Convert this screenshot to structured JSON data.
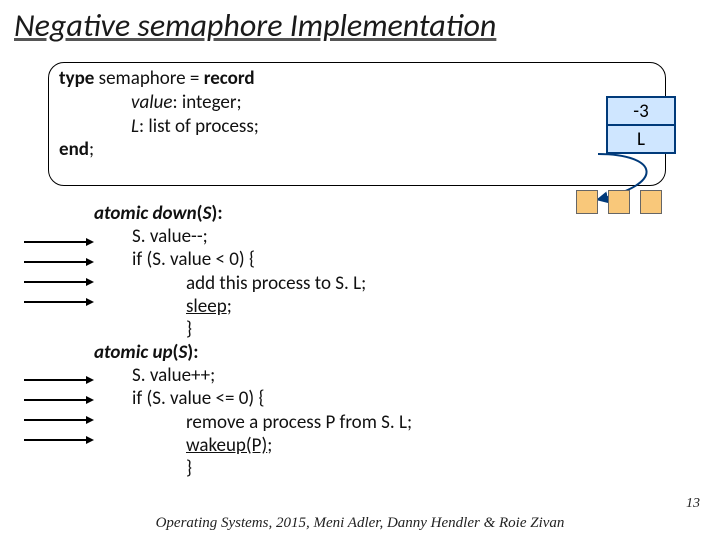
{
  "title": "Negative semaphore Implementation",
  "type_def": {
    "head_type": "type",
    "head_rest": " semaphore = ",
    "head_record": "record",
    "field1_name": "value",
    "field1_rest": ": integer;",
    "field2_name": "L",
    "field2_rest": ": list of process;",
    "end": "end"
  },
  "diagram": {
    "value": "-3",
    "list_label": "L"
  },
  "code": {
    "down_head_a": "atomic down",
    "down_head_b": "(",
    "down_head_c": "S",
    "down_head_d": "):",
    "d1": "S. value--;",
    "d2": "if (S. value < 0) {",
    "d3": "add this process to S. L;",
    "d4_u": "sleep",
    "d4_rest": ";",
    "d5": "}",
    "up_head_a": "atomic up",
    "up_head_b": "(",
    "up_head_c": "S",
    "up_head_d": "):",
    "u1": "S. value++;",
    "u2": "if (S. value <= 0) {",
    "u3": "remove a process P from S. L;",
    "u4_u": "wakeup(P)",
    "u4_rest": ";",
    "u5": "}"
  },
  "footer": "Operating Systems, 2015, Meni Adler, Danny Hendler & Roie Zivan",
  "page": "13"
}
